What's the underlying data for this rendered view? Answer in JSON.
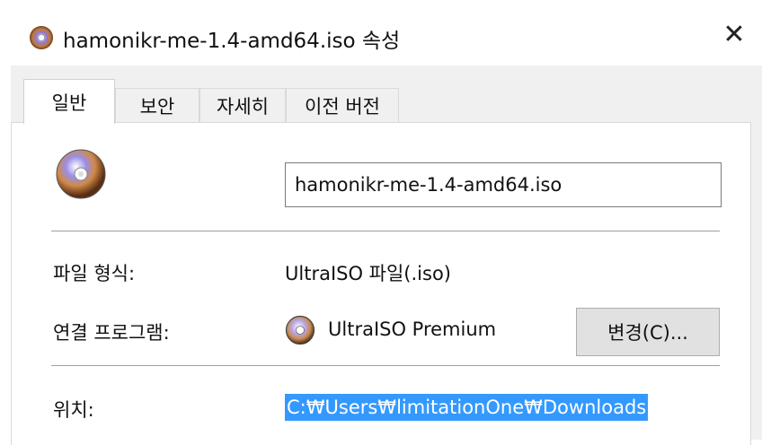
{
  "window": {
    "title": "hamonikr-me-1.4-amd64.iso 속성",
    "close_glyph": "✕"
  },
  "tabs": [
    {
      "label": "일반",
      "active": true
    },
    {
      "label": "보안",
      "active": false
    },
    {
      "label": "자세히",
      "active": false
    },
    {
      "label": "이전 버전",
      "active": false
    }
  ],
  "general": {
    "file_name": "hamonikr-me-1.4-amd64.iso",
    "file_type_label": "파일 형식:",
    "file_type_value": "UltraISO 파일(.iso)",
    "opens_with_label": "연결 프로그램:",
    "opens_with_value": "UltraISO Premium",
    "change_button_label": "변경(C)...",
    "location_label": "위치:",
    "location_value": "C:₩Users₩limitationOne₩Downloads"
  },
  "icons": {
    "title_icon": "disc-icon",
    "file_icon": "disc-icon",
    "app_icon": "ultraiso-icon",
    "close_icon": "close-icon"
  },
  "colors": {
    "selection": "#3399ff",
    "button_bg": "#e1e1e1",
    "dialog_bg": "#f0f0f0"
  }
}
